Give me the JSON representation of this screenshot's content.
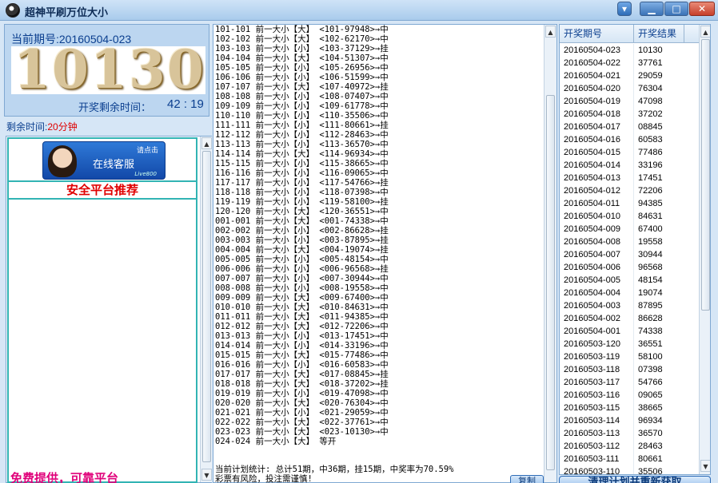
{
  "window": {
    "title": "超神平刷万位大小",
    "skin_icon": "tshirt-icon",
    "min_glyph": "▁",
    "max_glyph": "□",
    "close_glyph": "✕"
  },
  "current": {
    "label": "当前期号:20160504-023",
    "digits": [
      "1",
      "0",
      "1",
      "3",
      "0"
    ],
    "countdown_label": "开奖剩余时间：",
    "countdown_time": "42 : 19"
  },
  "remain": {
    "label": "剩余时间:",
    "value": "20分钟"
  },
  "ad": {
    "service_text": "在线客服",
    "click_text": "请点击",
    "live_text": "Live800",
    "title": "安全平台推荐",
    "footer": "免费提供，可靠平台"
  },
  "plan_lines": [
    "101-101 前一大小【大】 <101-97948>→中",
    "102-102 前一大小【大】 <102-62170>→中",
    "103-103 前一大小【小】 <103-37129>→挂",
    "104-104 前一大小【大】 <104-51307>→中",
    "105-105 前一大小【小】 <105-26956>→中",
    "106-106 前一大小【小】 <106-51599>→中",
    "107-107 前一大小【大】 <107-40972>→挂",
    "108-108 前一大小【小】 <108-07407>→中",
    "109-109 前一大小【小】 <109-61778>→中",
    "110-110 前一大小【小】 <110-35506>→中",
    "111-111 前一大小【小】 <111-80661>→挂",
    "112-112 前一大小【小】 <112-28463>→中",
    "113-113 前一大小【小】 <113-36570>→中",
    "114-114 前一大小【大】 <114-96934>→中",
    "115-115 前一大小【小】 <115-38665>→中",
    "116-116 前一大小【小】 <116-09065>→中",
    "117-117 前一大小【小】 <117-54766>→挂",
    "118-118 前一大小【小】 <118-07398>→中",
    "119-119 前一大小【小】 <119-58100>→挂",
    "120-120 前一大小【大】 <120-36551>→中",
    "001-001 前一大小【大】 <001-74338>→中",
    "002-002 前一大小【小】 <002-86628>→挂",
    "003-003 前一大小【小】 <003-87895>→挂",
    "004-004 前一大小【大】 <004-19074>→挂",
    "005-005 前一大小【小】 <005-48154>→中",
    "006-006 前一大小【小】 <006-96568>→挂",
    "007-007 前一大小【小】 <007-30944>→中",
    "008-008 前一大小【小】 <008-19558>→中",
    "009-009 前一大小【大】 <009-67400>→中",
    "010-010 前一大小【大】 <010-84631>→中",
    "011-011 前一大小【大】 <011-94385>→中",
    "012-012 前一大小【大】 <012-72206>→中",
    "013-013 前一大小【小】 <013-17451>→中",
    "014-014 前一大小【小】 <014-33196>→中",
    "015-015 前一大小【大】 <015-77486>→中",
    "016-016 前一大小【小】 <016-60583>→中",
    "017-017 前一大小【大】 <017-08845>→挂",
    "018-018 前一大小【大】 <018-37202>→挂",
    "019-019 前一大小【小】 <019-47098>→中",
    "020-020 前一大小【大】 <020-76304>→中",
    "021-021 前一大小【小】 <021-29059>→中",
    "022-022 前一大小【大】 <022-37761>→中",
    "023-023 前一大小【大】 <023-10130>→中",
    "024-024 前一大小【大】 等开"
  ],
  "stats": {
    "line1": "当前计划统计: 总计51期，中36期，挂15期，中奖率为70.59%",
    "line2": "彩票有风险，投注需谨慎!"
  },
  "copy_button": "复制",
  "table": {
    "col1": "开奖期号",
    "col2": "开奖结果",
    "rows": [
      [
        "20160504-023",
        "10130"
      ],
      [
        "20160504-022",
        "37761"
      ],
      [
        "20160504-021",
        "29059"
      ],
      [
        "20160504-020",
        "76304"
      ],
      [
        "20160504-019",
        "47098"
      ],
      [
        "20160504-018",
        "37202"
      ],
      [
        "20160504-017",
        "08845"
      ],
      [
        "20160504-016",
        "60583"
      ],
      [
        "20160504-015",
        "77486"
      ],
      [
        "20160504-014",
        "33196"
      ],
      [
        "20160504-013",
        "17451"
      ],
      [
        "20160504-012",
        "72206"
      ],
      [
        "20160504-011",
        "94385"
      ],
      [
        "20160504-010",
        "84631"
      ],
      [
        "20160504-009",
        "67400"
      ],
      [
        "20160504-008",
        "19558"
      ],
      [
        "20160504-007",
        "30944"
      ],
      [
        "20160504-006",
        "96568"
      ],
      [
        "20160504-005",
        "48154"
      ],
      [
        "20160504-004",
        "19074"
      ],
      [
        "20160504-003",
        "87895"
      ],
      [
        "20160504-002",
        "86628"
      ],
      [
        "20160504-001",
        "74338"
      ],
      [
        "20160503-120",
        "36551"
      ],
      [
        "20160503-119",
        "58100"
      ],
      [
        "20160503-118",
        "07398"
      ],
      [
        "20160503-117",
        "54766"
      ],
      [
        "20160503-116",
        "09065"
      ],
      [
        "20160503-115",
        "38665"
      ],
      [
        "20160503-114",
        "96934"
      ],
      [
        "20160503-113",
        "36570"
      ],
      [
        "20160503-112",
        "28463"
      ],
      [
        "20160503-111",
        "80661"
      ],
      [
        "20160503-110",
        "35506"
      ]
    ]
  },
  "clear_button": "清理计划并重新获取"
}
